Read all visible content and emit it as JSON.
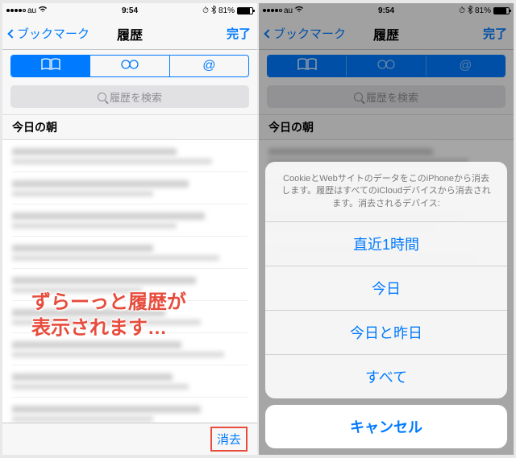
{
  "status": {
    "carrier": "au",
    "time": "9:54",
    "battery_pct": "81%"
  },
  "nav": {
    "back": "ブックマーク",
    "title": "履歴",
    "done": "完了"
  },
  "search": {
    "placeholder": "履歴を検索"
  },
  "section": {
    "header": "今日の朝"
  },
  "toolbar": {
    "clear": "消去"
  },
  "overlay": {
    "line1": "ずらーっと履歴が",
    "line2": "表示されます…"
  },
  "sheet": {
    "message": "CookieとWebサイトのデータをこのiPhoneから消去します。履歴はすべてのiCloudデバイスから消去されます。消去されるデバイス:",
    "opt1": "直近1時間",
    "opt2": "今日",
    "opt3": "今日と昨日",
    "opt4": "すべて",
    "cancel": "キャンセル"
  }
}
